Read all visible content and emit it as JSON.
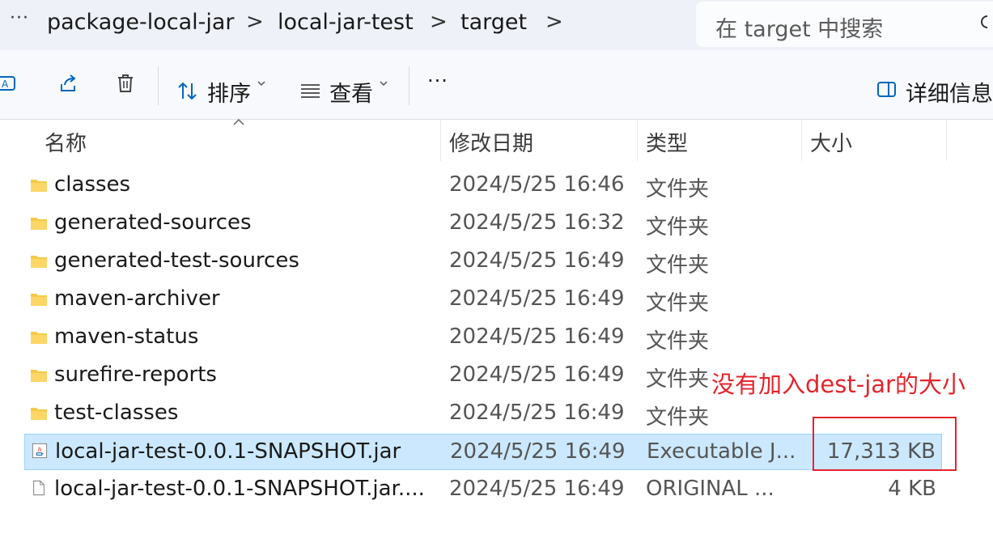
{
  "breadcrumb": {
    "more": "···",
    "items": [
      "package-local-jar",
      "local-jar-test",
      "target"
    ],
    "separator": ">"
  },
  "search": {
    "placeholder": "在 target 中搜索"
  },
  "toolbar": {
    "sort_label": "排序",
    "view_label": "查看",
    "more_label": "···",
    "details_label": "详细信息"
  },
  "columns": {
    "name": "名称",
    "modified": "修改日期",
    "type": "类型",
    "size": "大小"
  },
  "files": [
    {
      "name": "classes",
      "modified": "2024/5/25 16:46",
      "type": "文件夹",
      "size": "",
      "icon": "folder-icon"
    },
    {
      "name": "generated-sources",
      "modified": "2024/5/25 16:32",
      "type": "文件夹",
      "size": "",
      "icon": "folder-icon"
    },
    {
      "name": "generated-test-sources",
      "modified": "2024/5/25 16:49",
      "type": "文件夹",
      "size": "",
      "icon": "folder-icon"
    },
    {
      "name": "maven-archiver",
      "modified": "2024/5/25 16:49",
      "type": "文件夹",
      "size": "",
      "icon": "folder-icon"
    },
    {
      "name": "maven-status",
      "modified": "2024/5/25 16:49",
      "type": "文件夹",
      "size": "",
      "icon": "folder-icon"
    },
    {
      "name": "surefire-reports",
      "modified": "2024/5/25 16:49",
      "type": "文件夹",
      "size": "",
      "icon": "folder-icon"
    },
    {
      "name": "test-classes",
      "modified": "2024/5/25 16:49",
      "type": "文件夹",
      "size": "",
      "icon": "folder-icon"
    },
    {
      "name": "local-jar-test-0.0.1-SNAPSHOT.jar",
      "modified": "2024/5/25 16:49",
      "type": "Executable J...",
      "size": "17,313 KB",
      "icon": "java-jar-icon",
      "selected": true
    },
    {
      "name": "local-jar-test-0.0.1-SNAPSHOT.jar....",
      "modified": "2024/5/25 16:49",
      "type": "ORIGINAL ...",
      "size": "4 KB",
      "icon": "file-icon"
    }
  ],
  "annotation": {
    "text": "没有加入dest-jar的大小",
    "color": "#e5242b"
  },
  "colors": {
    "selection": "#cce8ff",
    "folder": "#f8c945",
    "accent": "#0067c0"
  }
}
